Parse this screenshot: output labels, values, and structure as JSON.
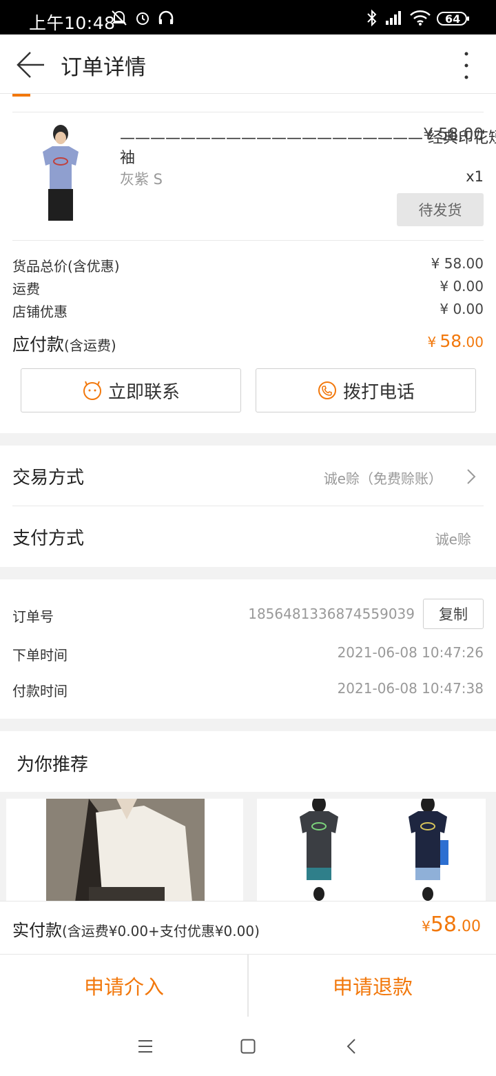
{
  "status_bar": {
    "time": "上午10:48",
    "battery": "64"
  },
  "header": {
    "title": "订单详情"
  },
  "product": {
    "name_line1": "———————————————————— 经典印花短",
    "name_line2": "袖",
    "price": "¥ 58.00",
    "variant": "灰紫 S",
    "quantity": "x1",
    "status_button": "待发货"
  },
  "summary": {
    "goods_total_label": "货品总价(含优惠)",
    "goods_total_value": "¥ 58.00",
    "shipping_label": "运费",
    "shipping_value": "¥ 0.00",
    "shop_discount_label": "店铺优惠",
    "shop_discount_value": "¥ 0.00",
    "payable_label": "应付款",
    "payable_sub": "(含运费)",
    "payable_currency": "¥",
    "payable_int": "58",
    "payable_dec": ".00"
  },
  "contact": {
    "contact_now": "立即联系",
    "call_phone": "拨打电话"
  },
  "trade": {
    "method_label": "交易方式",
    "method_value": "诚e赊（免费赊账）",
    "payment_label": "支付方式",
    "payment_value": "诚e赊"
  },
  "order_info": {
    "order_no_label": "订单号",
    "order_no": "1856481336874559039",
    "copy_button": "复制",
    "order_time_label": "下单时间",
    "order_time": "2021-06-08 10:47:26",
    "pay_time_label": "付款时间",
    "pay_time": "2021-06-08 10:47:38"
  },
  "recommend": {
    "title": "为你推荐"
  },
  "bottom": {
    "paid_label": "实付款",
    "paid_detail": "(含运费¥0.00+支付优惠¥0.00)",
    "paid_currency": "¥",
    "paid_int": "58",
    "paid_dec": ".00"
  },
  "actions": {
    "intervene": "申请介入",
    "refund": "申请退款"
  },
  "colors": {
    "accent": "#f2780c",
    "band": "#f2f2f2"
  }
}
